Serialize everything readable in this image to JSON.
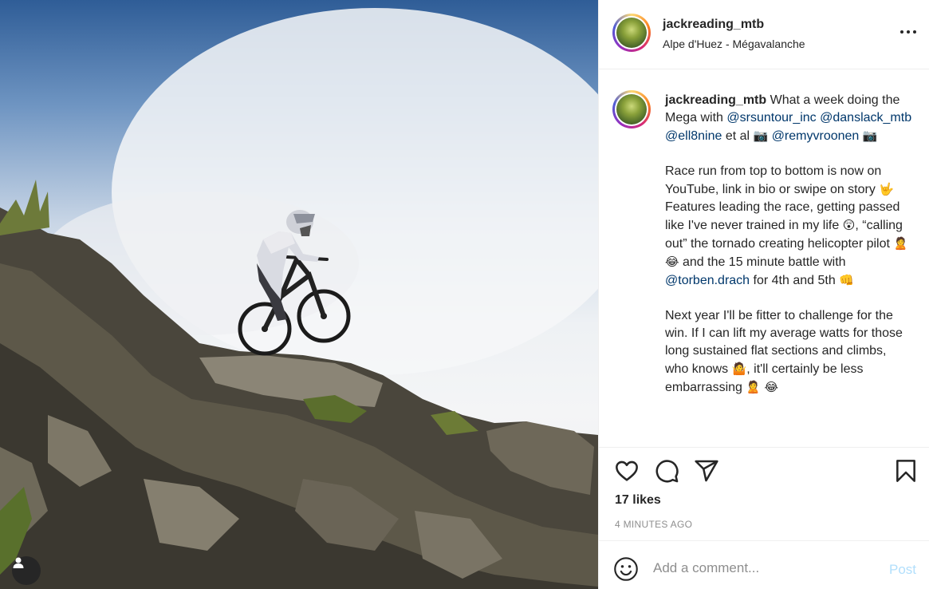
{
  "post": {
    "username": "jackreading_mtb",
    "location": "Alpe d'Huez - Mégavalanche"
  },
  "caption": {
    "username": "jackreading_mtb",
    "line1": " What a week doing the Mega with ",
    "mention1": "@srsuntour_inc",
    "mention2": "@danslack_mtb",
    "mention3": "@ell8nine",
    "text_et_al": " et al ",
    "emoji_camera": "📷",
    "mention4": "@remyvroonen",
    "para2_a": "Race run from top to bottom is now on YouTube, link in bio or swipe on story ",
    "emoji_hand": "🤟",
    "para2_b": " Features leading the race, getting passed like I've never trained in my life ",
    "emoji_shock": "😲",
    "para2_c": ", “calling out” the tornado creating helicopter pilot ",
    "emoji_person": "🙎",
    "emoji_laugh": "😂",
    "para2_d": " and the 15 minute battle with ",
    "mention5": "@torben.drach",
    "para2_e": " for 4th and 5th ",
    "emoji_fist": "👊",
    "para3_a": "Next year I'll be fitter to challenge for the win. If I can lift my average watts for those long sustained flat sections and climbs, who knows ",
    "emoji_shrug": "🤷",
    "para3_b": ", it'll certainly be less embarrassing "
  },
  "stats": {
    "likes": "17 likes",
    "time": "4 MINUTES AGO"
  },
  "comment": {
    "placeholder": "Add a comment...",
    "post_label": "Post"
  },
  "icons": {
    "like": "heart-icon",
    "comment": "comment-bubble-icon",
    "share": "paper-plane-icon",
    "save": "bookmark-icon",
    "more": "more-dots-icon",
    "emoji": "smiley-icon",
    "user_tags": "user-silhouette-icon"
  },
  "colors": {
    "link": "#00376b",
    "post_disabled": "#b2dffc",
    "muted": "#8e8e8e",
    "border": "#efefef"
  }
}
